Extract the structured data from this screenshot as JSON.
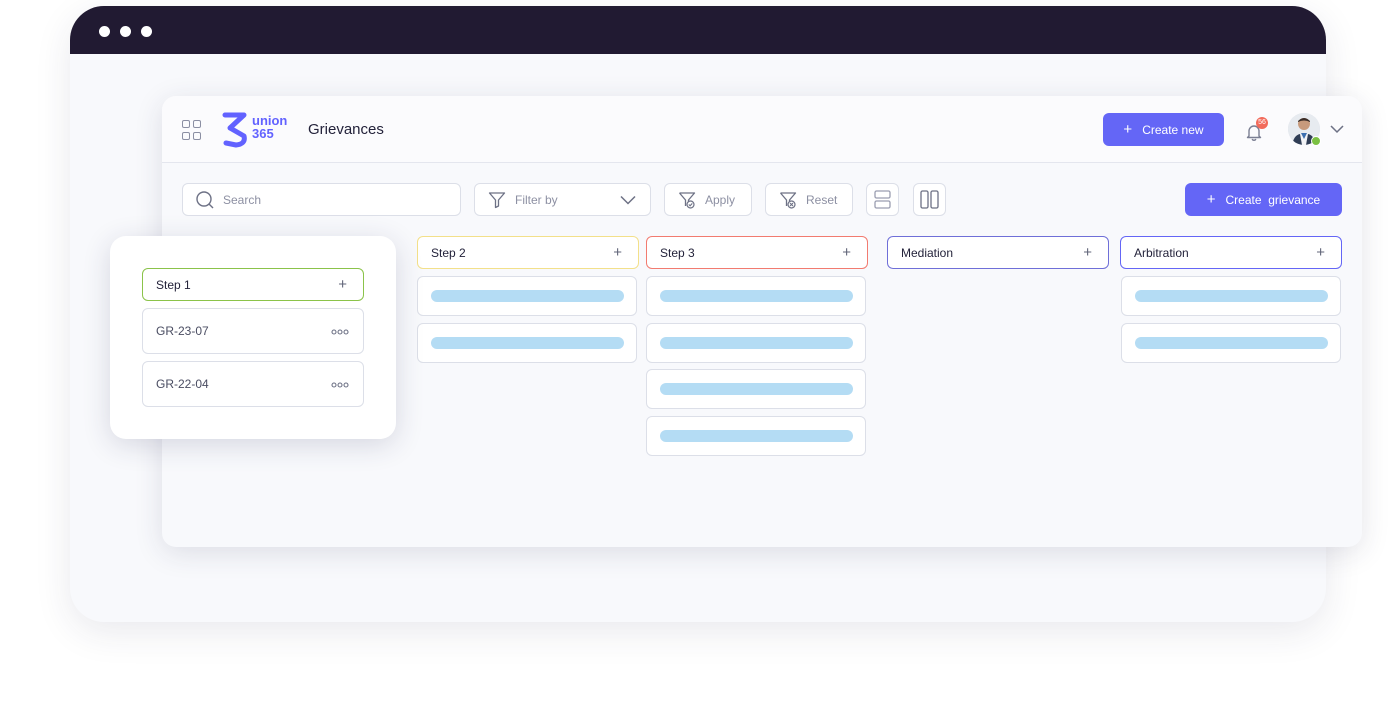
{
  "app": {
    "brand_line1": "union",
    "brand_line2": "365",
    "page_title": "Grievances",
    "create_new_label": "Create new",
    "notification_count": "56"
  },
  "toolbar": {
    "search_placeholder": "Search",
    "filter_label": "Filter by",
    "apply_label": "Apply",
    "reset_label": "Reset",
    "create_grievance_label": "Create  grievance"
  },
  "columns": [
    {
      "title": "Step 1",
      "color": "#8bc34a",
      "items": [
        "GR-23-07",
        "GR-22-04"
      ]
    },
    {
      "title": "Step 2",
      "color": "#f3e08a",
      "placeholder_cards": 2
    },
    {
      "title": "Step 3",
      "color": "#f27b70",
      "placeholder_cards": 4
    },
    {
      "title": "Mediation",
      "color": "#6f6fd8",
      "placeholder_cards": 0
    },
    {
      "title": "Arbitration",
      "color": "#6466f6",
      "placeholder_cards": 2
    }
  ],
  "colors": {
    "primary": "#6466f6",
    "browser_bar": "#211a32",
    "placeholder_bar": "#b4dcf4",
    "badge": "#f26b5b",
    "online": "#7bc043"
  }
}
